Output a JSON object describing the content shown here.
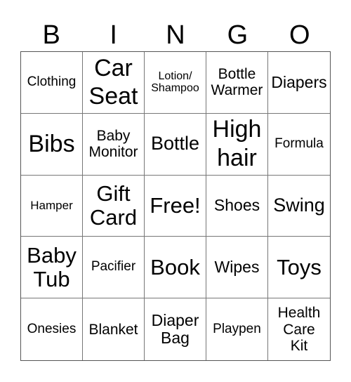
{
  "header": [
    "B",
    "I",
    "N",
    "G",
    "O"
  ],
  "cells": [
    [
      "Clothing",
      "Car\nSeat",
      "Lotion/\nShampoo",
      "Bottle\nWarmer",
      "Diapers"
    ],
    [
      "Bibs",
      "Baby\nMonitor",
      "Bottle",
      "High\nhair",
      "Formula"
    ],
    [
      "Hamper",
      "Gift\nCard",
      "Free!",
      "Shoes",
      "Swing"
    ],
    [
      "Baby\nTub",
      "Pacifier",
      "Book",
      "Wipes",
      "Toys"
    ],
    [
      "Onesies",
      "Blanket",
      "Diaper\nBag",
      "Playpen",
      "Health\nCare\nKit"
    ]
  ]
}
